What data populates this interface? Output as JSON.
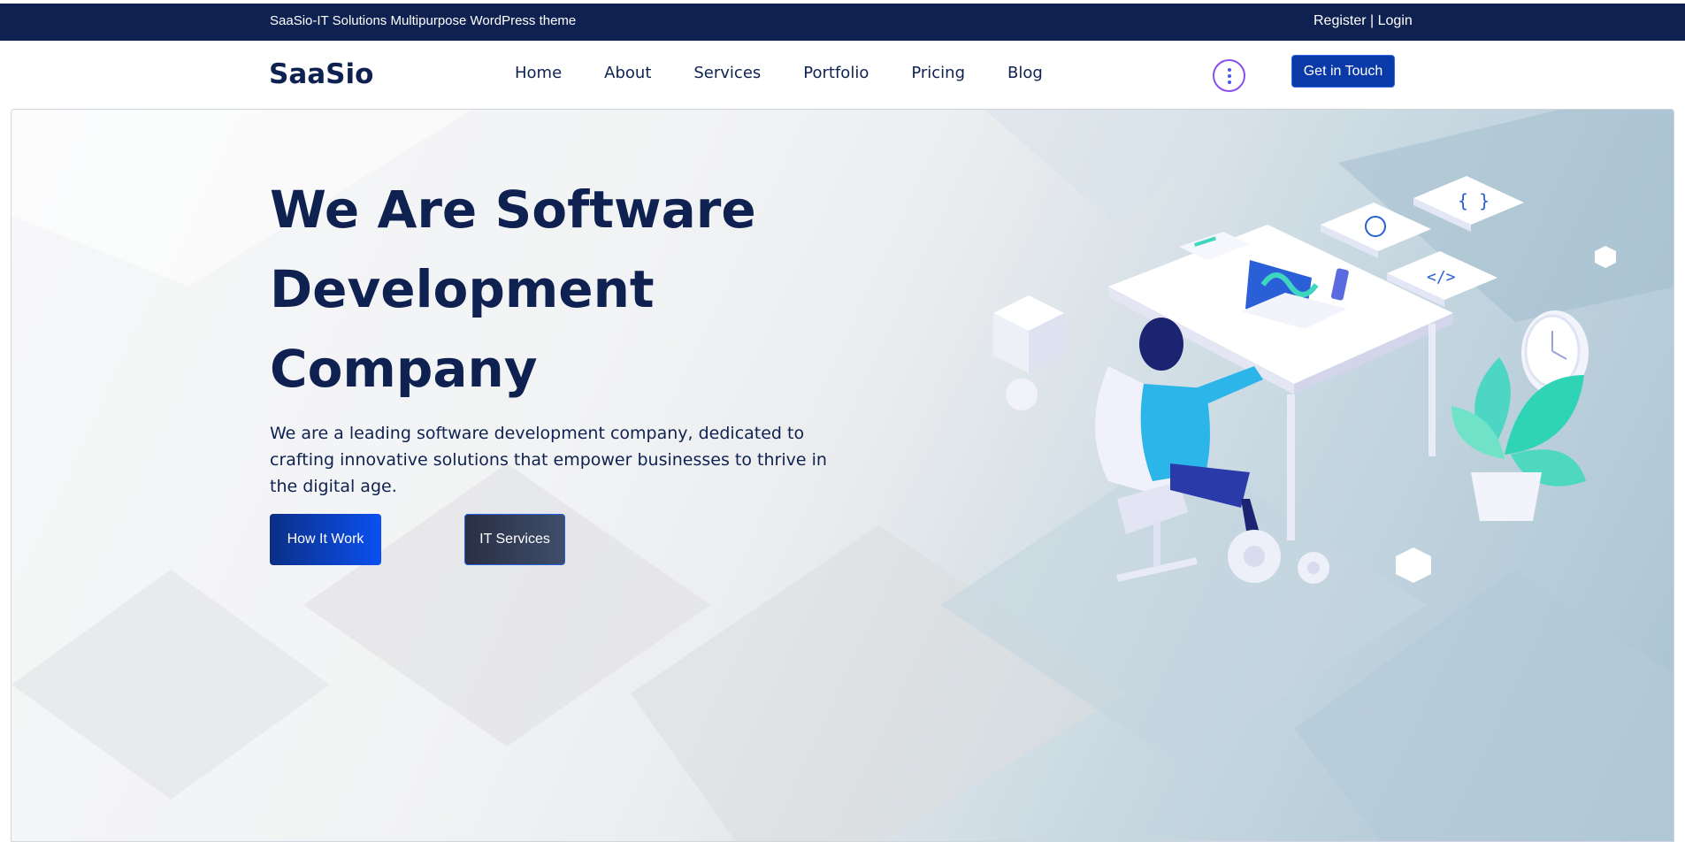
{
  "topbar": {
    "tagline": "SaaSio-IT Solutions Multipurpose WordPress theme",
    "register": "Register",
    "separator": " | ",
    "login": "Login"
  },
  "nav": {
    "logo": "SaaSio",
    "items": [
      {
        "label": "Home"
      },
      {
        "label": "About"
      },
      {
        "label": "Services"
      },
      {
        "label": "Portfolio"
      },
      {
        "label": "Pricing"
      },
      {
        "label": "Blog"
      }
    ],
    "cta": "Get in Touch"
  },
  "hero": {
    "title_line1": "We Are Software",
    "title_line2": "Development",
    "title_line3": "Company",
    "description": "We are a leading software development company, dedicated to crafting innovative solutions that empower businesses to thrive in the digital age.",
    "primary_button": "How It Work",
    "secondary_button": "IT Services"
  },
  "colors": {
    "navy": "#0e2150",
    "accent": "#0a3aa8",
    "teal": "#3fd6c0"
  }
}
